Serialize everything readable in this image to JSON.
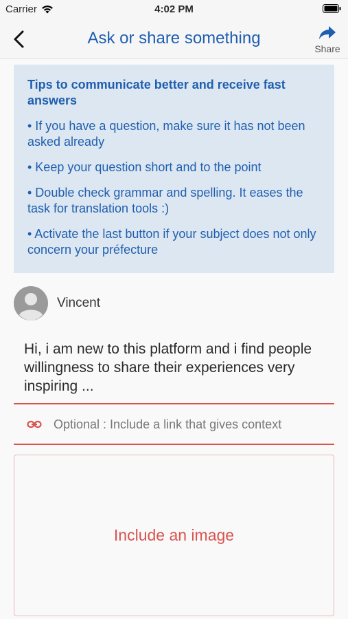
{
  "status_bar": {
    "carrier": "Carrier",
    "time": "4:02 PM"
  },
  "nav": {
    "title": "Ask or share something",
    "share_label": "Share"
  },
  "tips": {
    "title": "Tips to communicate better and receive fast answers",
    "items": [
      "• If you have a question, make sure it has not been asked already",
      "• Keep your question short and to the point",
      "• Double check grammar and spelling. It eases the task for translation tools :)",
      "• Activate the last button if your subject does not only concern your préfecture"
    ]
  },
  "author": {
    "name": "Vincent"
  },
  "message": "Hi, i am new to this platform and i find people willingness to share their experiences very inspiring ...",
  "link_field": {
    "placeholder": "Optional : Include a link that gives context"
  },
  "image_box": {
    "label": "Include an image"
  },
  "colors": {
    "accent": "#1f5fb0",
    "danger": "#d9534f",
    "tips_bg": "#dde7f1"
  }
}
